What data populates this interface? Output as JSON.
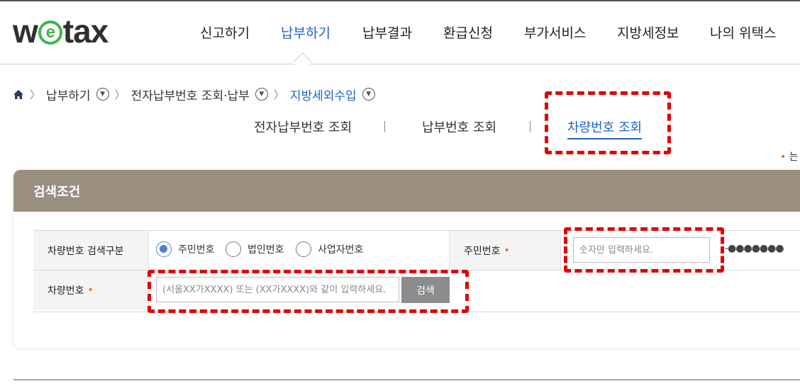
{
  "logo": {
    "pre": "w",
    "circle": "e",
    "post": "tax"
  },
  "nav": {
    "items": [
      {
        "label": "신고하기"
      },
      {
        "label": "납부하기",
        "active": true
      },
      {
        "label": "납부결과"
      },
      {
        "label": "환급신청"
      },
      {
        "label": "부가서비스"
      },
      {
        "label": "지방세정보"
      },
      {
        "label": "나의 위택스"
      }
    ]
  },
  "breadcrumb": {
    "home_icon": "home-icon",
    "items": [
      "납부하기",
      "전자납부번호 조회·납부",
      "지방세외수입"
    ]
  },
  "subtabs": [
    "전자납부번호 조회",
    "납부번호 조회",
    "차량번호 조회"
  ],
  "note": {
    "dot": "•",
    "text": "는"
  },
  "panel": {
    "title": "검색조건"
  },
  "form": {
    "search_type_label": "차량번호 검색구분",
    "radios": [
      {
        "label": "주민번호",
        "checked": true
      },
      {
        "label": "법인번호",
        "checked": false
      },
      {
        "label": "사업자번호",
        "checked": false
      }
    ],
    "resident_label": "주민번호",
    "resident_placeholder": "숫자만 입력하세요.",
    "masked_value": "-●●●●●●●",
    "vehicle_label": "차량번호",
    "vehicle_placeholder": "(서울XX가XXXX) 또는 (XX가XXXX)와 같이 입력하세요.",
    "search_button": "검색",
    "required_mark": "•"
  },
  "colors": {
    "accent": "#1f62c8",
    "panel_header": "#9a8f7f",
    "required": "#e86c1e",
    "highlight": "#e00000",
    "logo_green": "#3cb84a"
  }
}
